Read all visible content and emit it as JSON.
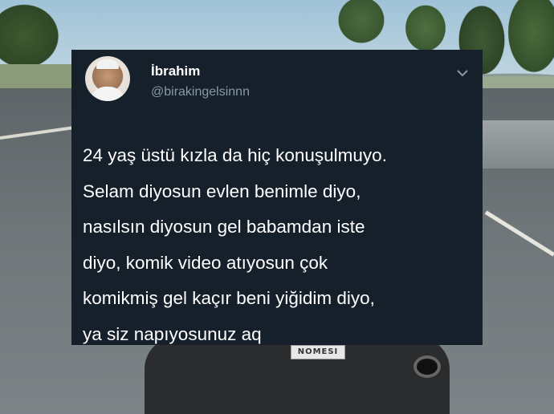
{
  "tweet": {
    "display_name": "İbrahim",
    "handle": "@birakingelsinnn",
    "text_lines": [
      "24 yaş üstü kızla da hiç konuşulmuyo.",
      "Selam diyosun evlen benimle diyo,",
      "nasılsın diyosun gel babamdan iste",
      "diyo, komik video atıyosun çok",
      "komikmiş gel kaçır beni yiğidim diyo,",
      "ya siz napıyosunuz aq"
    ],
    "menu_icon": "chevron-down-icon"
  },
  "background": {
    "plate_text": "NOMESI"
  },
  "colors": {
    "card_bg": "#15202b",
    "text_primary": "#ffffff",
    "text_secondary": "#8899a6"
  }
}
